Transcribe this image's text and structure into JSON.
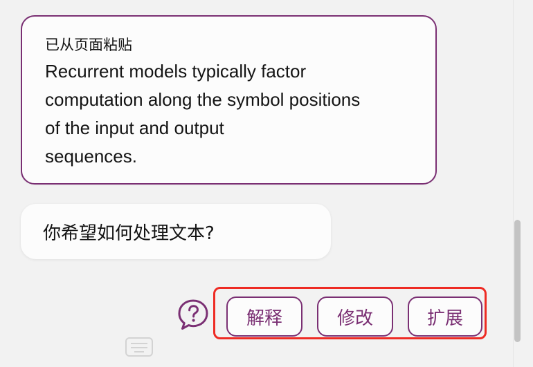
{
  "paste_card": {
    "label": "已从页面粘贴",
    "body": "Recurrent models typically factor\ncomputation along the symbol positions\nof the input and output\nsequences."
  },
  "question": {
    "text": "你希望如何处理文本?"
  },
  "actions": {
    "help_icon": "question-circle-icon",
    "explain_label": "解释",
    "revise_label": "修改",
    "expand_label": "扩展"
  },
  "colors": {
    "accent": "#7a2f73",
    "highlight": "#ee2b24",
    "background": "#f2f2f2",
    "card": "#fcfcfc"
  }
}
